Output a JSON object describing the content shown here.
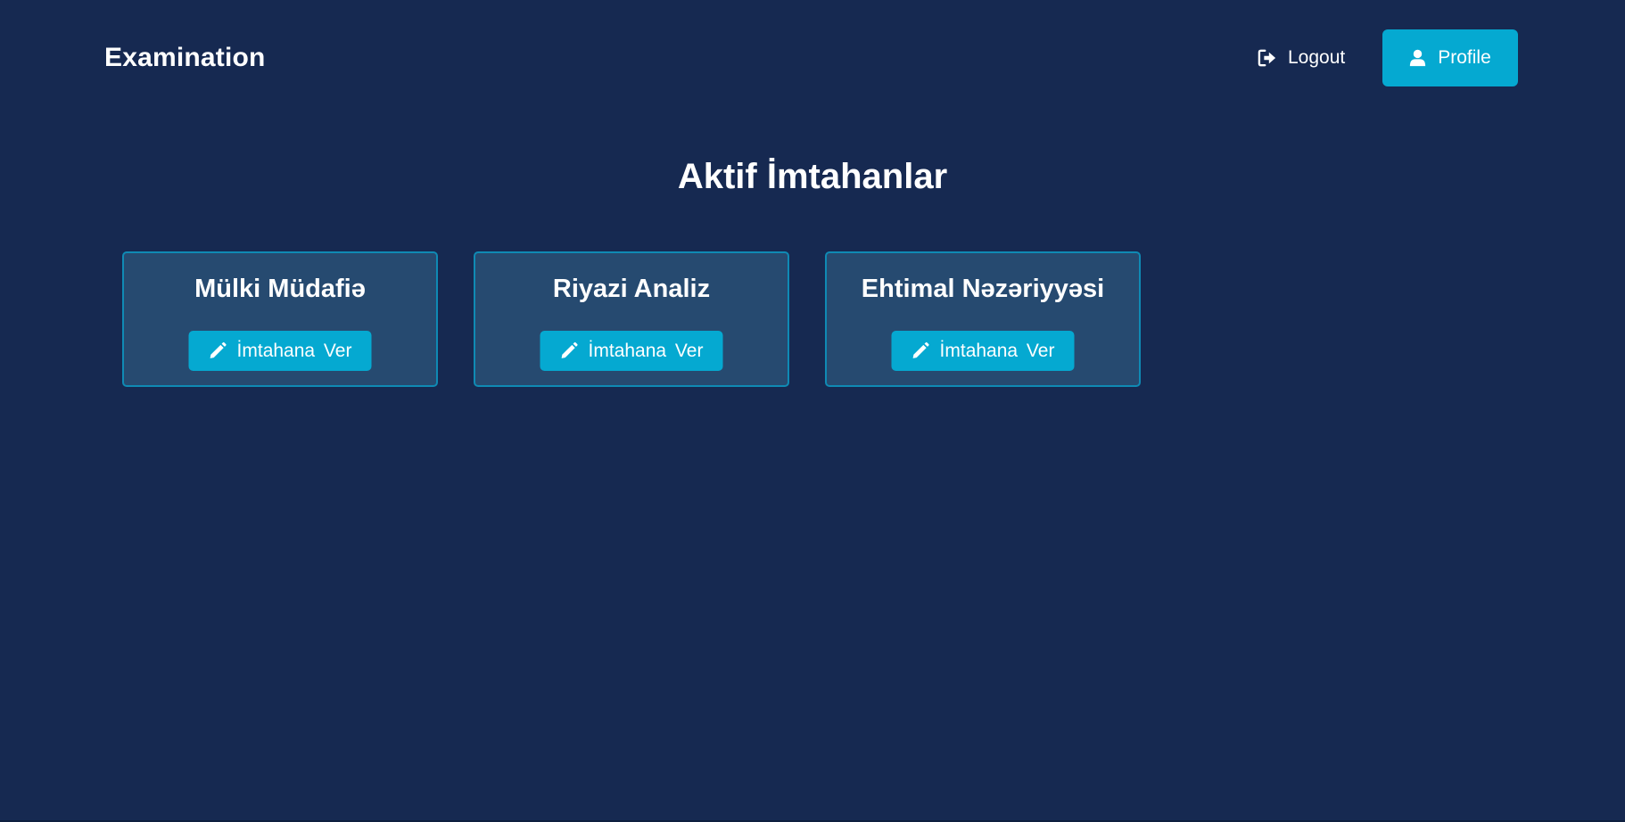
{
  "navbar": {
    "brand": "Examination",
    "logout": {
      "label": "Logout",
      "icon": "logout-icon"
    },
    "profile": {
      "label": "Profile",
      "icon": "user-icon"
    }
  },
  "main": {
    "title": "Aktif İmtahanlar",
    "exams": [
      {
        "title": "Mülki Müdafiə",
        "action_label": "İmtahana Ver",
        "action_icon": "pencil-icon"
      },
      {
        "title": "Riyazi Analiz",
        "action_label": "İmtahana Ver",
        "action_icon": "pencil-icon"
      },
      {
        "title": "Ehtimal Nəzəriyyəsi",
        "action_label": "İmtahana Ver",
        "action_icon": "pencil-icon"
      }
    ]
  },
  "colors": {
    "background": "#162951",
    "card_background": "#264a70",
    "card_border": "#0f8ab4",
    "accent": "#05a9d1",
    "text": "#ffffff"
  }
}
